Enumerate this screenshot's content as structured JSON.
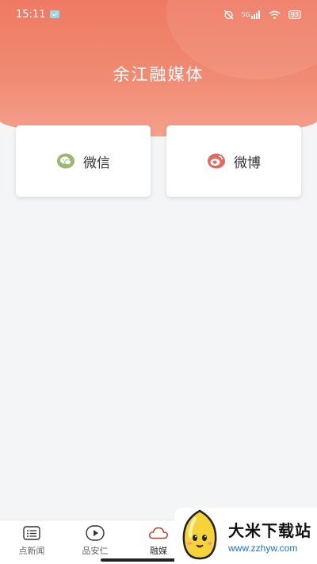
{
  "status_bar": {
    "time": "15:11",
    "icons": [
      "app-check-icon",
      "alarm-off-icon",
      "signal-icon",
      "wifi-icon",
      "battery-icon"
    ],
    "signal_label": "5G",
    "battery_level": "93"
  },
  "header": {
    "title": "余江融媒体"
  },
  "cards": [
    {
      "label": "微信",
      "icon": "wechat-icon",
      "icon_color": "#9bb86e"
    },
    {
      "label": "微博",
      "icon": "weibo-icon",
      "icon_color": "#e36a63"
    }
  ],
  "bottom_nav": {
    "items": [
      {
        "label": "点新闻",
        "icon": "list-icon",
        "active": false
      },
      {
        "label": "品安仁",
        "icon": "play-icon",
        "active": false
      },
      {
        "label": "融媒",
        "icon": "cloud-icon",
        "active": true
      }
    ]
  },
  "watermark": {
    "title": "大米下载站",
    "url": "www.zzhyw.com"
  },
  "colors": {
    "header_gradient_top": "#ef7a63",
    "header_gradient_bottom": "#f4a08d",
    "background": "#f4f5f7",
    "active_nav_icon": "#c0392b"
  }
}
